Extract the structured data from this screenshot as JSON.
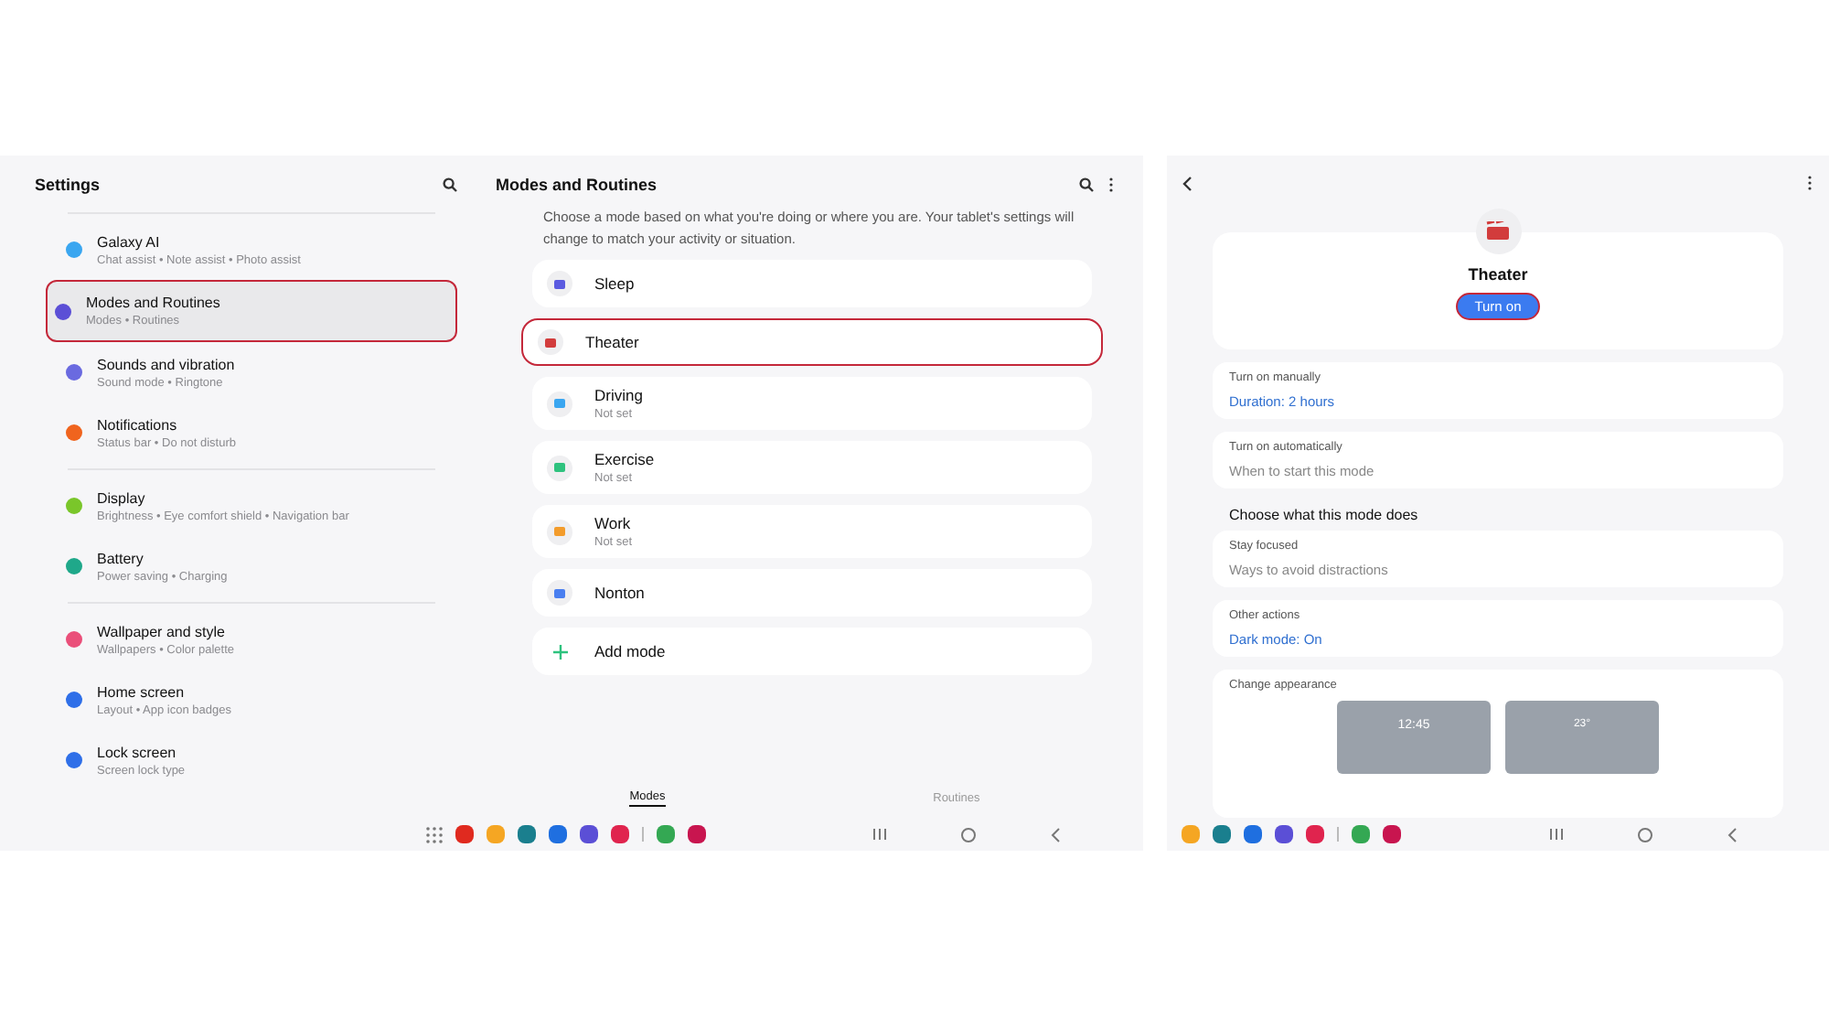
{
  "settings": {
    "title": "Settings",
    "groups": [
      [
        {
          "title": "Galaxy AI",
          "subtitle": "Chat assist • Note assist • Photo assist",
          "color": "#3aa6f0",
          "highlighted": false
        },
        {
          "title": "Modes and Routines",
          "subtitle": "Modes • Routines",
          "color": "#5b4fd6",
          "highlighted": true
        },
        {
          "title": "Sounds and vibration",
          "subtitle": "Sound mode • Ringtone",
          "color": "#6a6ae0",
          "highlighted": false
        },
        {
          "title": "Notifications",
          "subtitle": "Status bar • Do not disturb",
          "color": "#f0641e",
          "highlighted": false
        }
      ],
      [
        {
          "title": "Display",
          "subtitle": "Brightness • Eye comfort shield • Navigation bar",
          "color": "#7ac62a",
          "highlighted": false
        },
        {
          "title": "Battery",
          "subtitle": "Power saving • Charging",
          "color": "#1fa88a",
          "highlighted": false
        }
      ],
      [
        {
          "title": "Wallpaper and style",
          "subtitle": "Wallpapers • Color palette",
          "color": "#ea4f7a",
          "highlighted": false
        },
        {
          "title": "Home screen",
          "subtitle": "Layout • App icon badges",
          "color": "#2f6fe8",
          "highlighted": false
        },
        {
          "title": "Lock screen",
          "subtitle": "Screen lock type",
          "color": "#2f6fe8",
          "highlighted": false
        }
      ]
    ]
  },
  "modes": {
    "title": "Modes and Routines",
    "description": "Choose a mode based on what you're doing or where you are. Your tablet's settings will change to match your activity or situation.",
    "items": [
      {
        "kind": "mode",
        "title": "Sleep",
        "color": "#5a5ae0",
        "highlighted": false
      },
      {
        "kind": "mode",
        "title": "Theater",
        "color": "#d23c3c",
        "highlighted": true
      },
      {
        "kind": "mode",
        "title": "Driving",
        "subtitle": "Not set",
        "color": "#3aa6f0",
        "highlighted": false
      },
      {
        "kind": "mode",
        "title": "Exercise",
        "subtitle": "Not set",
        "color": "#2ec27e",
        "highlighted": false
      },
      {
        "kind": "mode",
        "title": "Work",
        "subtitle": "Not set",
        "color": "#f39c2b",
        "highlighted": false
      },
      {
        "kind": "mode",
        "title": "Nonton",
        "color": "#4a7ff0",
        "highlighted": false
      },
      {
        "kind": "add",
        "title": "Add mode",
        "color": "#2ec27e",
        "highlighted": false
      }
    ],
    "tabs": [
      {
        "label": "Modes",
        "selected": true
      },
      {
        "label": "Routines",
        "selected": false
      }
    ]
  },
  "taskbar_left": [
    {
      "color": "#e02a1f"
    },
    {
      "color": "#f5a623"
    },
    {
      "color": "#1a7f8e"
    },
    {
      "color": "#1f6fe0"
    },
    {
      "color": "#5b4fd6"
    },
    {
      "color": "#e0244e"
    },
    {
      "color": "#34a853"
    },
    {
      "color": "#c8154f"
    }
  ],
  "taskbar_right": [
    {
      "color": "#f5a623"
    },
    {
      "color": "#1a7f8e"
    },
    {
      "color": "#1f6fe0"
    },
    {
      "color": "#5b4fd6"
    },
    {
      "color": "#e0244e"
    },
    {
      "color": "#34a853"
    },
    {
      "color": "#c8154f"
    }
  ],
  "detail": {
    "title": "Theater",
    "button": {
      "label": "Turn on",
      "highlighted": true
    },
    "sections": [
      {
        "title": "Turn on manually",
        "value": "Duration: 2 hours",
        "link": true
      },
      {
        "title": "Turn on automatically",
        "value": "When to start this mode",
        "link": false
      }
    ],
    "heading": "Choose what this mode does",
    "actions": [
      {
        "title": "Stay focused",
        "value": "Ways to avoid distractions",
        "link": false
      },
      {
        "title": "Other actions",
        "value": "Dark mode: On",
        "link": true
      }
    ],
    "appearance": {
      "title": "Change appearance",
      "clock": "12:45",
      "weather": "23°"
    }
  }
}
